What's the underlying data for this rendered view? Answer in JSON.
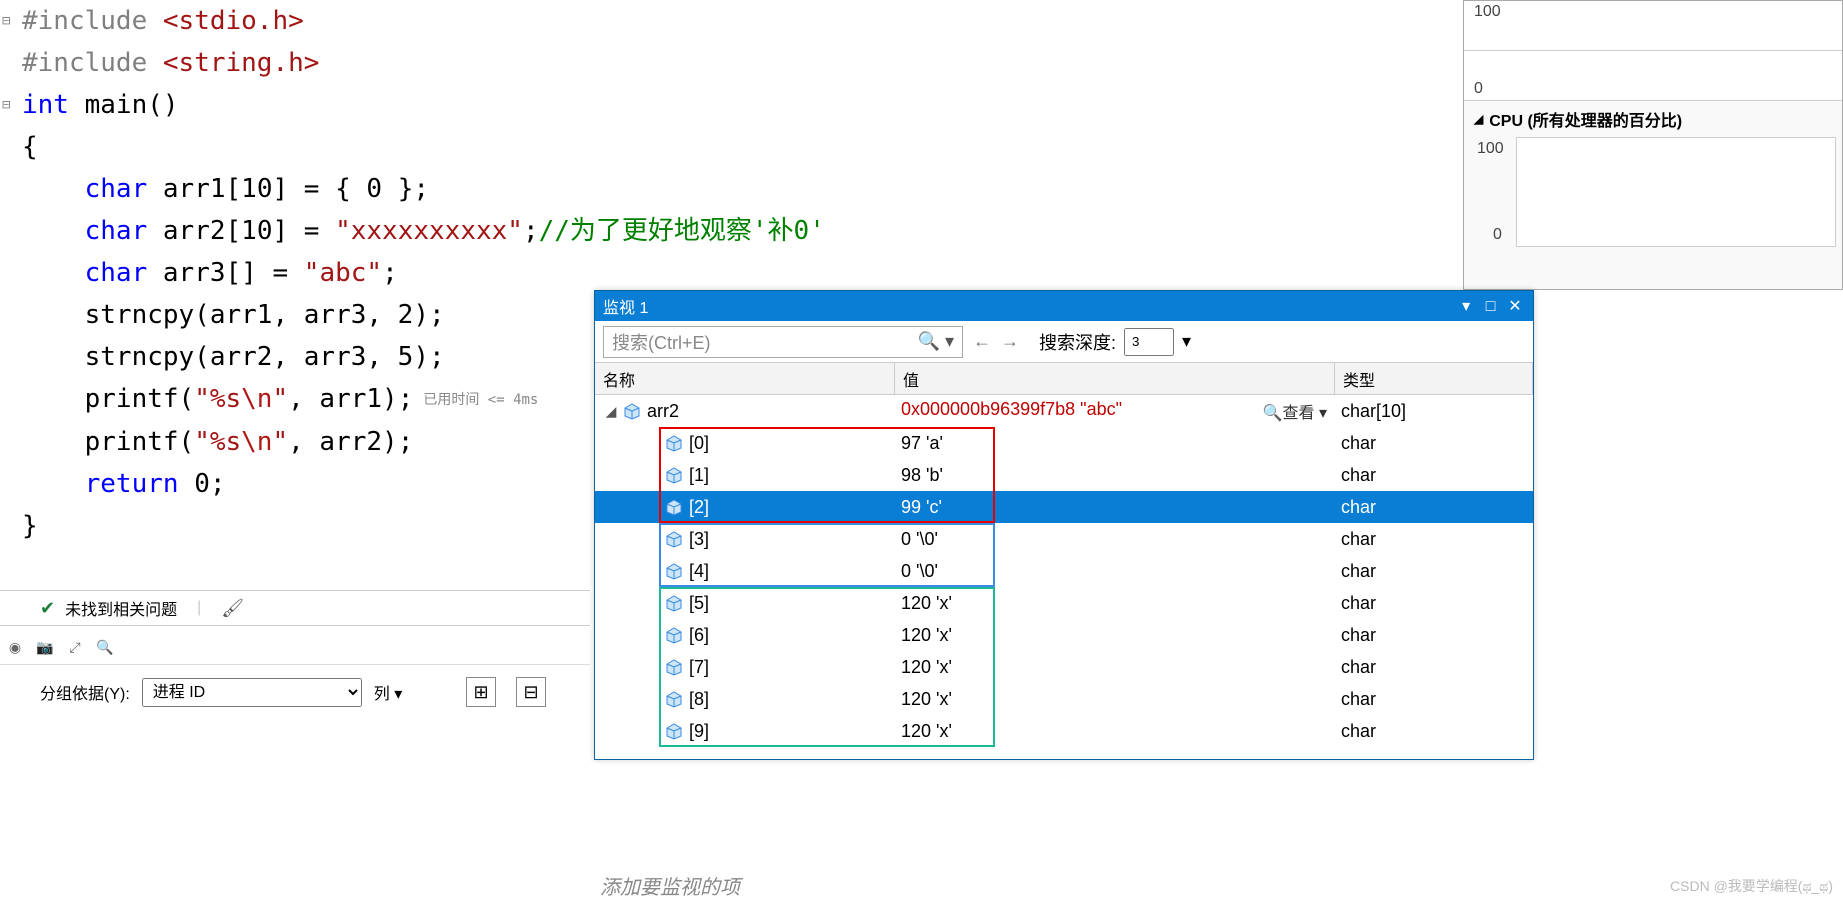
{
  "code": {
    "lines": [
      {
        "fold": "⊟"
      },
      {},
      {
        "fold": "⊟"
      },
      {},
      {},
      {},
      {},
      {},
      {},
      {},
      {},
      {},
      {}
    ],
    "include1a": "#include ",
    "include1b": "<stdio.h>",
    "include2a": "#include ",
    "include2b": "<string.h>",
    "l3_int": "int",
    "l3_rest": " main()",
    "brace_open": "{",
    "l5_char": "char",
    "l5_rest": " arr1[10] = { 0 };",
    "l6_char": "char",
    "l6_mid": " arr2[10] = ",
    "l6_str": "\"xxxxxxxxxx\"",
    "l6_semicolon": ";",
    "l6_comment": "//为了更好地观察'补0'",
    "l7_char": "char",
    "l7_mid": " arr3[] = ",
    "l7_str": "\"abc\"",
    "l7_semicolon": ";",
    "l8": "    strncpy(arr1, arr3, 2);",
    "l9": "    strncpy(arr2, arr3, 5);",
    "l10a": "    printf(",
    "l10s1": "\"%s",
    "l10esc": "\\n",
    "l10s2": "\"",
    "l10b": ", arr1);",
    "perf_hint": "已用时间 <= 4ms",
    "l11a": "    printf(",
    "l11s1": "\"%s",
    "l11esc": "\\n",
    "l11s2": "\"",
    "l11b": ", arr2);",
    "l12_ret": "return",
    "l12_val": " 0;",
    "brace_close": "}"
  },
  "problems": {
    "text": "未找到相关问题",
    "group_label": "分组依据(Y):",
    "group_value": "进程 ID",
    "col_label": "列 ▾"
  },
  "perf": {
    "top_big": "100",
    "top_zero": "0",
    "cpu_header": "CPU (所有处理器的百分比)",
    "big_hundred": "100",
    "big_zero": "0"
  },
  "watch": {
    "title": "监视 1",
    "search_placeholder": "搜索(Ctrl+E)",
    "depth_label": "搜索深度:",
    "depth_value": "3",
    "header_name": "名称",
    "header_value": "值",
    "header_type": "类型",
    "root": {
      "name": "arr2",
      "value": "0x000000b96399f7b8 \"abc\"",
      "view_label": "🔍查看 ▾",
      "type": "char[10]"
    },
    "items": [
      {
        "name": "[0]",
        "value": "97 'a'",
        "type": "char",
        "sel": false
      },
      {
        "name": "[1]",
        "value": "98 'b'",
        "type": "char",
        "sel": false
      },
      {
        "name": "[2]",
        "value": "99 'c'",
        "type": "char",
        "sel": true
      },
      {
        "name": "[3]",
        "value": "0 '\\0'",
        "type": "char",
        "sel": false
      },
      {
        "name": "[4]",
        "value": "0 '\\0'",
        "type": "char",
        "sel": false
      },
      {
        "name": "[5]",
        "value": "120 'x'",
        "type": "char",
        "sel": false
      },
      {
        "name": "[6]",
        "value": "120 'x'",
        "type": "char",
        "sel": false
      },
      {
        "name": "[7]",
        "value": "120 'x'",
        "type": "char",
        "sel": false
      },
      {
        "name": "[8]",
        "value": "120 'x'",
        "type": "char",
        "sel": false
      },
      {
        "name": "[9]",
        "value": "120 'x'",
        "type": "char",
        "sel": false
      }
    ],
    "add_hint": "添加要监视的项"
  },
  "watermark": "CSDN @我要学编程(ಥ_ಥ)",
  "chart_data": {
    "type": "line",
    "series": [
      {
        "name": "top-mini",
        "values": [],
        "ylim": [
          0,
          100
        ]
      },
      {
        "name": "cpu",
        "values": [],
        "ylim": [
          0,
          100
        ],
        "title": "CPU (所有处理器的百分比)"
      }
    ]
  }
}
